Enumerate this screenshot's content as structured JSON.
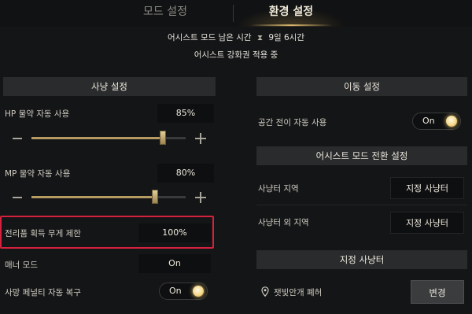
{
  "tabs": {
    "mode": "모드 설정",
    "env": "환경 설정"
  },
  "info": {
    "remaining_label": "어시스트 모드 남은 시간",
    "remaining_value": "9일 6시간",
    "status": "어시스트 강화권 적용 중"
  },
  "hunting": {
    "header": "사냥 설정",
    "hp": {
      "label": "HP 물약 자동 사용",
      "value": "85%",
      "level": 0.85
    },
    "mp": {
      "label": "MP 물약 자동 사용",
      "value": "80%",
      "level": 0.8
    },
    "loot": {
      "label": "전리품 획득 무게 제한",
      "value": "100%"
    },
    "manner": {
      "label": "매너 모드",
      "value": "On"
    },
    "penalty": {
      "label": "사망 페널티 자동 복구",
      "value": "On"
    }
  },
  "movement": {
    "header": "이동 설정",
    "teleport": {
      "label": "공간 전이 자동 사용",
      "value": "On"
    }
  },
  "assist_switch": {
    "header": "어시스트 모드 전환 설정",
    "in_zone": {
      "label": "사냥터 지역",
      "button": "지정 사냥터"
    },
    "out_zone": {
      "label": "사냥터 외 지역",
      "button": "지정 사냥터"
    }
  },
  "designated": {
    "header": "지정 사냥터",
    "location": "잿빛안개 폐허",
    "change_button": "변경"
  },
  "colors": {
    "accent": "#d8b66e",
    "highlight": "#d4213d",
    "knob": "#f5d98a"
  }
}
